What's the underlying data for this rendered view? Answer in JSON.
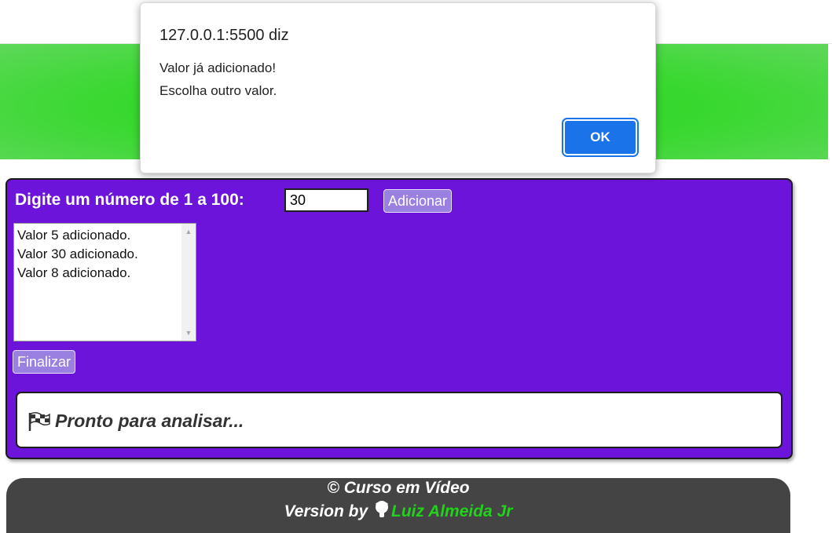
{
  "form": {
    "prompt_label": "Digite um número de 1 a 100:",
    "number_value": "30",
    "add_button": "Adicionar",
    "finish_button": "Finalizar"
  },
  "list": {
    "items": [
      "Valor 5 adicionado.",
      "Valor 30 adicionado.",
      "Valor 8 adicionado."
    ]
  },
  "result": {
    "icon": "checkered-flag-icon",
    "text": "Pronto para analisar..."
  },
  "footer": {
    "line1": "© Curso em Vídeo",
    "line2_prefix": "Version by",
    "author_icon": "github-icon",
    "author": "Luiz Almeida Jr"
  },
  "dialog": {
    "origin": "127.0.0.1:5500 diz",
    "message_line1": "Valor já adicionado!",
    "message_line2": "Escolha outro valor.",
    "ok_label": "OK"
  },
  "colors": {
    "header_green": "#2fd62a",
    "main_purple": "#6c14d9",
    "button_lavender": "#9a80e0",
    "footer_gray": "#444444",
    "author_green": "#23d11c",
    "dialog_blue": "#1a73e8"
  }
}
